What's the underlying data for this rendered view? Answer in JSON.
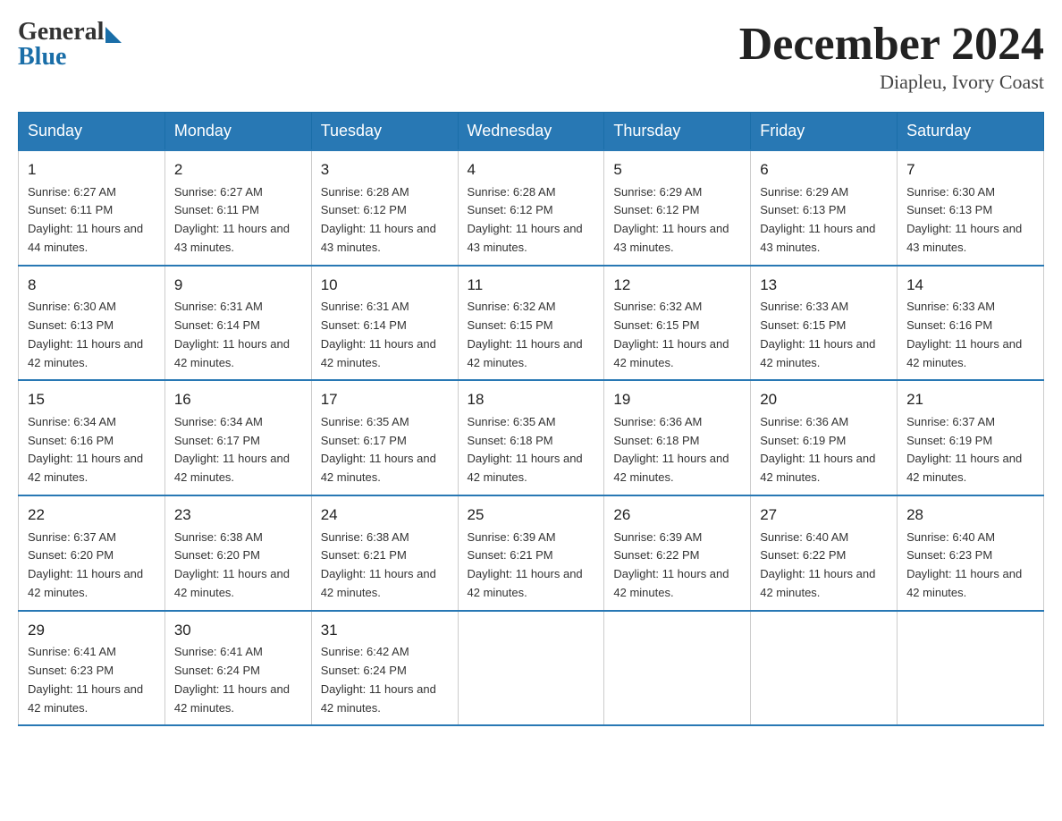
{
  "logo": {
    "general": "General",
    "blue": "Blue"
  },
  "header": {
    "title": "December 2024",
    "location": "Diapleu, Ivory Coast"
  },
  "days_of_week": [
    "Sunday",
    "Monday",
    "Tuesday",
    "Wednesday",
    "Thursday",
    "Friday",
    "Saturday"
  ],
  "weeks": [
    [
      {
        "day": 1,
        "sunrise": "6:27 AM",
        "sunset": "6:11 PM",
        "daylight": "11 hours and 44 minutes."
      },
      {
        "day": 2,
        "sunrise": "6:27 AM",
        "sunset": "6:11 PM",
        "daylight": "11 hours and 43 minutes."
      },
      {
        "day": 3,
        "sunrise": "6:28 AM",
        "sunset": "6:12 PM",
        "daylight": "11 hours and 43 minutes."
      },
      {
        "day": 4,
        "sunrise": "6:28 AM",
        "sunset": "6:12 PM",
        "daylight": "11 hours and 43 minutes."
      },
      {
        "day": 5,
        "sunrise": "6:29 AM",
        "sunset": "6:12 PM",
        "daylight": "11 hours and 43 minutes."
      },
      {
        "day": 6,
        "sunrise": "6:29 AM",
        "sunset": "6:13 PM",
        "daylight": "11 hours and 43 minutes."
      },
      {
        "day": 7,
        "sunrise": "6:30 AM",
        "sunset": "6:13 PM",
        "daylight": "11 hours and 43 minutes."
      }
    ],
    [
      {
        "day": 8,
        "sunrise": "6:30 AM",
        "sunset": "6:13 PM",
        "daylight": "11 hours and 42 minutes."
      },
      {
        "day": 9,
        "sunrise": "6:31 AM",
        "sunset": "6:14 PM",
        "daylight": "11 hours and 42 minutes."
      },
      {
        "day": 10,
        "sunrise": "6:31 AM",
        "sunset": "6:14 PM",
        "daylight": "11 hours and 42 minutes."
      },
      {
        "day": 11,
        "sunrise": "6:32 AM",
        "sunset": "6:15 PM",
        "daylight": "11 hours and 42 minutes."
      },
      {
        "day": 12,
        "sunrise": "6:32 AM",
        "sunset": "6:15 PM",
        "daylight": "11 hours and 42 minutes."
      },
      {
        "day": 13,
        "sunrise": "6:33 AM",
        "sunset": "6:15 PM",
        "daylight": "11 hours and 42 minutes."
      },
      {
        "day": 14,
        "sunrise": "6:33 AM",
        "sunset": "6:16 PM",
        "daylight": "11 hours and 42 minutes."
      }
    ],
    [
      {
        "day": 15,
        "sunrise": "6:34 AM",
        "sunset": "6:16 PM",
        "daylight": "11 hours and 42 minutes."
      },
      {
        "day": 16,
        "sunrise": "6:34 AM",
        "sunset": "6:17 PM",
        "daylight": "11 hours and 42 minutes."
      },
      {
        "day": 17,
        "sunrise": "6:35 AM",
        "sunset": "6:17 PM",
        "daylight": "11 hours and 42 minutes."
      },
      {
        "day": 18,
        "sunrise": "6:35 AM",
        "sunset": "6:18 PM",
        "daylight": "11 hours and 42 minutes."
      },
      {
        "day": 19,
        "sunrise": "6:36 AM",
        "sunset": "6:18 PM",
        "daylight": "11 hours and 42 minutes."
      },
      {
        "day": 20,
        "sunrise": "6:36 AM",
        "sunset": "6:19 PM",
        "daylight": "11 hours and 42 minutes."
      },
      {
        "day": 21,
        "sunrise": "6:37 AM",
        "sunset": "6:19 PM",
        "daylight": "11 hours and 42 minutes."
      }
    ],
    [
      {
        "day": 22,
        "sunrise": "6:37 AM",
        "sunset": "6:20 PM",
        "daylight": "11 hours and 42 minutes."
      },
      {
        "day": 23,
        "sunrise": "6:38 AM",
        "sunset": "6:20 PM",
        "daylight": "11 hours and 42 minutes."
      },
      {
        "day": 24,
        "sunrise": "6:38 AM",
        "sunset": "6:21 PM",
        "daylight": "11 hours and 42 minutes."
      },
      {
        "day": 25,
        "sunrise": "6:39 AM",
        "sunset": "6:21 PM",
        "daylight": "11 hours and 42 minutes."
      },
      {
        "day": 26,
        "sunrise": "6:39 AM",
        "sunset": "6:22 PM",
        "daylight": "11 hours and 42 minutes."
      },
      {
        "day": 27,
        "sunrise": "6:40 AM",
        "sunset": "6:22 PM",
        "daylight": "11 hours and 42 minutes."
      },
      {
        "day": 28,
        "sunrise": "6:40 AM",
        "sunset": "6:23 PM",
        "daylight": "11 hours and 42 minutes."
      }
    ],
    [
      {
        "day": 29,
        "sunrise": "6:41 AM",
        "sunset": "6:23 PM",
        "daylight": "11 hours and 42 minutes."
      },
      {
        "day": 30,
        "sunrise": "6:41 AM",
        "sunset": "6:24 PM",
        "daylight": "11 hours and 42 minutes."
      },
      {
        "day": 31,
        "sunrise": "6:42 AM",
        "sunset": "6:24 PM",
        "daylight": "11 hours and 42 minutes."
      },
      null,
      null,
      null,
      null
    ]
  ]
}
